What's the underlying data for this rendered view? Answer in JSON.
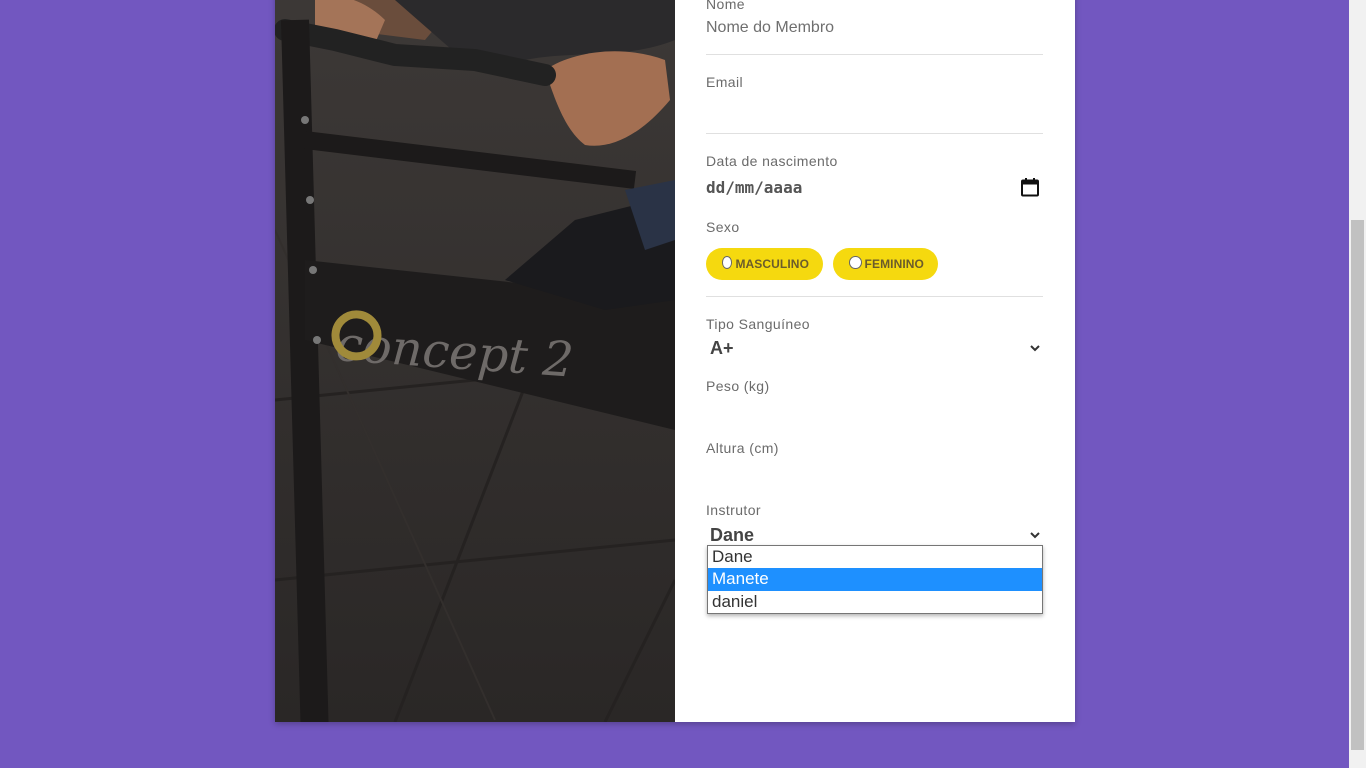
{
  "form": {
    "name": {
      "label": "Nome",
      "placeholder": "Nome do Membro"
    },
    "email": {
      "label": "Email",
      "value": ""
    },
    "birthdate": {
      "label": "Data de nascimento",
      "placeholder": "dd/mm/aaaa"
    },
    "sex": {
      "label": "Sexo",
      "options": [
        "MASCULINO",
        "FEMININO"
      ]
    },
    "blood_type": {
      "label": "Tipo Sanguíneo",
      "selected": "A+"
    },
    "weight": {
      "label": "Peso (kg)",
      "value": ""
    },
    "height": {
      "label": "Altura (cm)",
      "value": ""
    },
    "instructor": {
      "label": "Instrutor",
      "selected": "Dane",
      "options": [
        "Dane",
        "Manete",
        "daniel"
      ],
      "highlighted_index": 1
    }
  },
  "photo": {
    "brand_text": "concept 2"
  },
  "colors": {
    "background": "#7257c0",
    "pill": "#f5d90f",
    "highlight": "#1e90ff"
  },
  "icons": {
    "calendar": "calendar-icon",
    "chevron": "chevron-down-icon"
  }
}
